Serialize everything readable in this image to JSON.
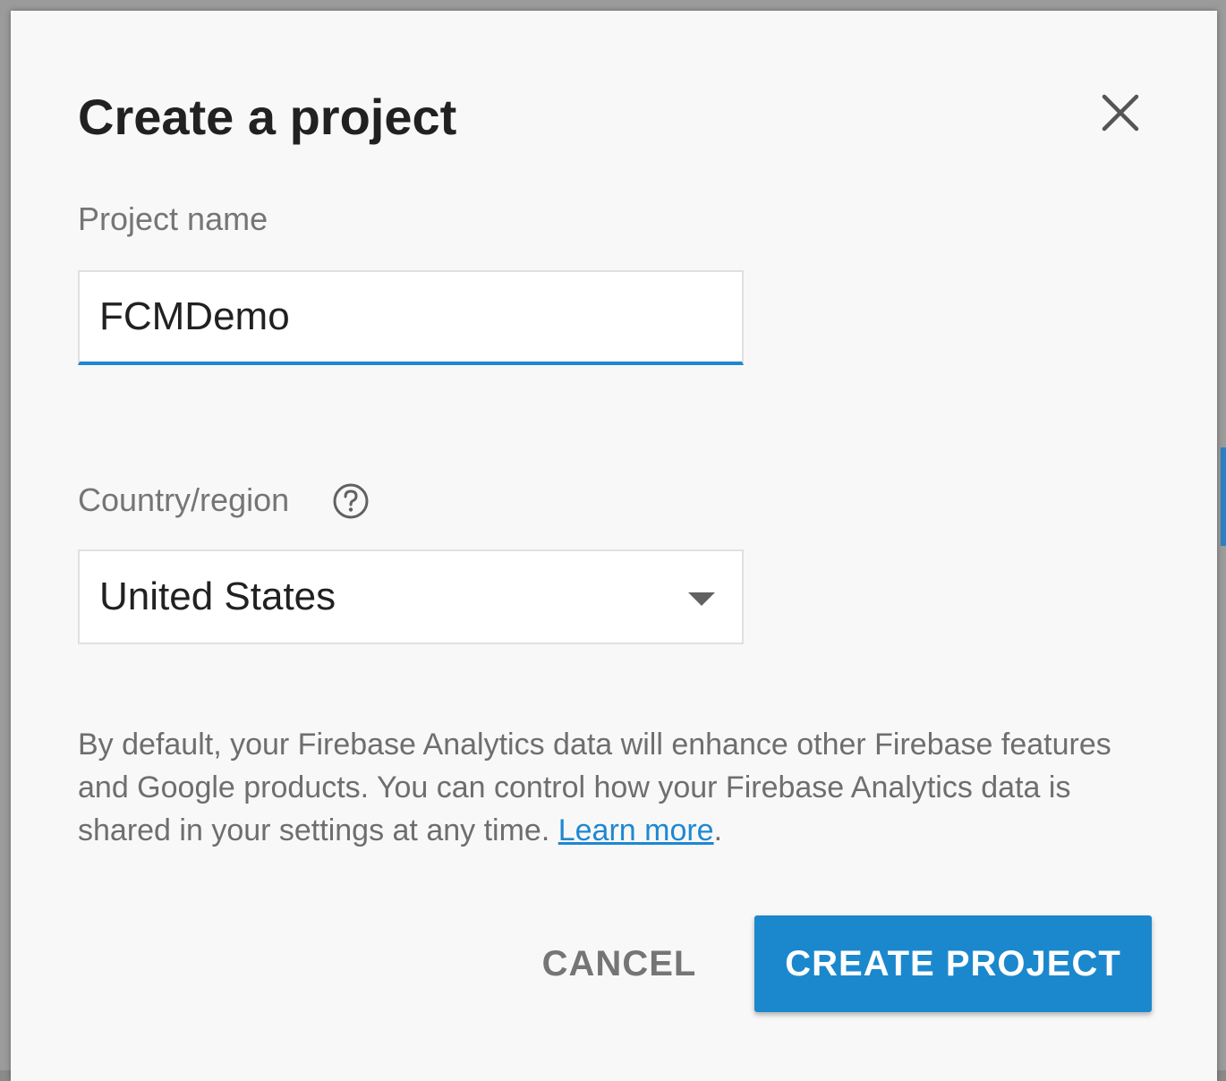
{
  "dialog": {
    "title": "Create a project",
    "close_icon": "close-icon",
    "project_name": {
      "label": "Project name",
      "value": "FCMDemo"
    },
    "country": {
      "label": "Country/region",
      "help_icon": "help-circle-icon",
      "selected": "United States",
      "caret_icon": "caret-down-icon"
    },
    "disclaimer": {
      "text": "By default, your Firebase Analytics data will enhance other Firebase features and Google products. You can control how your Firebase Analytics data is shared in your settings at any time. ",
      "link": "Learn more",
      "trailing": "."
    },
    "buttons": {
      "cancel": "CANCEL",
      "create": "CREATE PROJECT"
    }
  },
  "colors": {
    "accent": "#1b88cd",
    "title": "#212121",
    "muted": "#757575"
  }
}
